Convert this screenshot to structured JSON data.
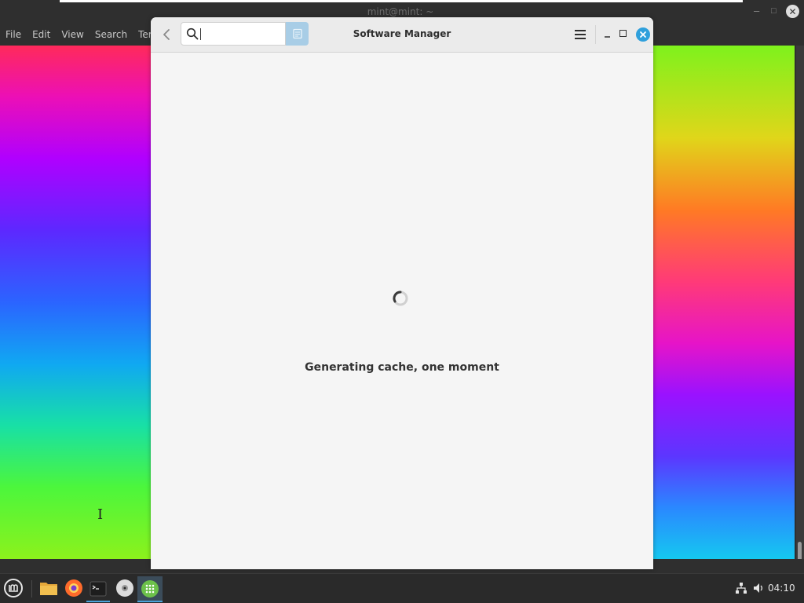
{
  "terminal_window": {
    "title": "mint@mint: ~",
    "menu": [
      "File",
      "Edit",
      "View",
      "Search",
      "Terminal"
    ]
  },
  "software_manager": {
    "title": "Software Manager",
    "search": {
      "value": "",
      "placeholder": ""
    },
    "status_message": "Generating cache, one moment",
    "accent_color": "#2fa0dc"
  },
  "taskbar": {
    "launchers": [
      "menu-icon",
      "files-icon",
      "firefox-icon",
      "terminal-icon",
      "disc-icon",
      "software-manager-icon"
    ],
    "clock": "04:10"
  }
}
